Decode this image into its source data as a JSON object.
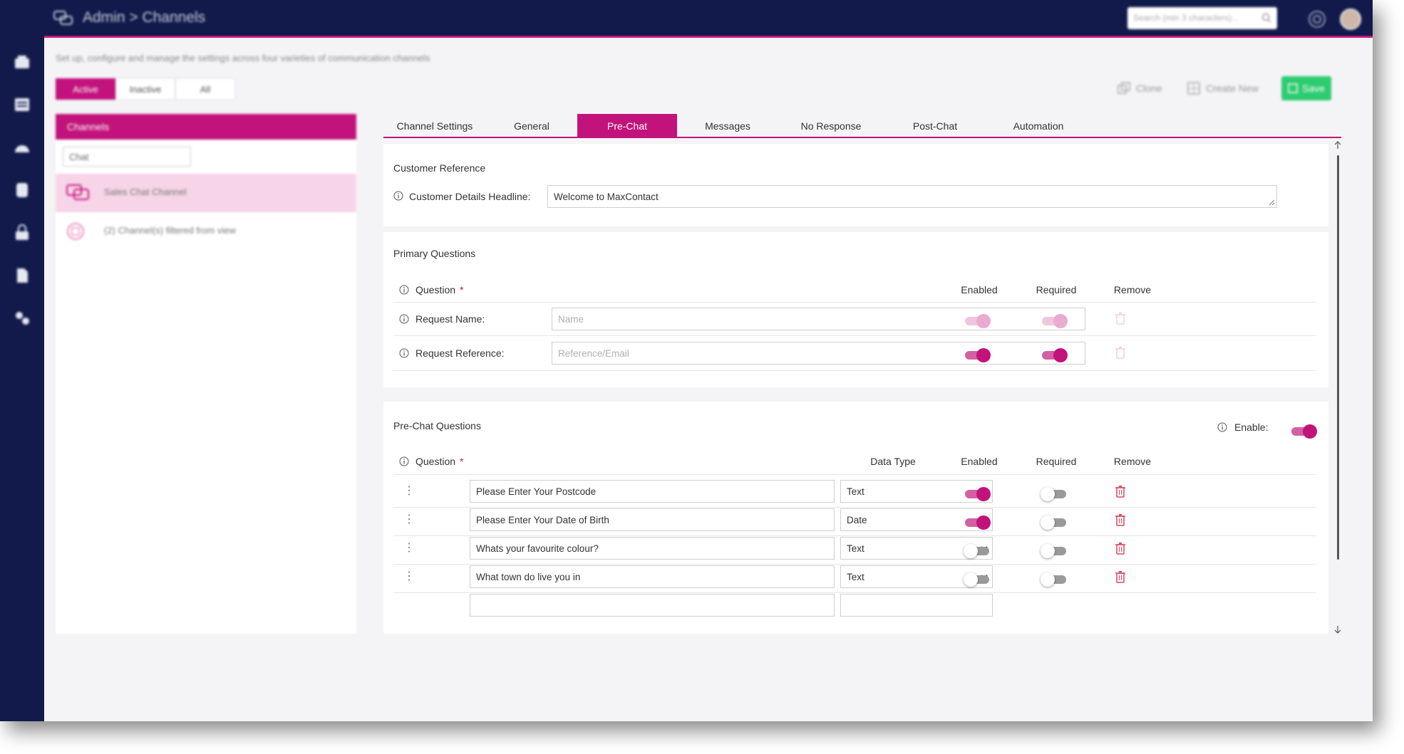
{
  "header": {
    "breadcrumb": "Admin > Channels",
    "search_placeholder": "Search (min 3 characters)..."
  },
  "page": {
    "description": "Set up, configure and manage the settings across four varieties of communication channels",
    "filter_tabs": [
      "Active",
      "Inactive",
      "All"
    ],
    "actions": {
      "clone": "Clone",
      "create_new": "Create New",
      "save": "Save"
    }
  },
  "channels_panel": {
    "title": "Channels",
    "type_filter": "Chat",
    "items": [
      {
        "label": "Sales Chat Channel"
      },
      {
        "label": "(2) Channel(s) filtered from view"
      }
    ]
  },
  "tabs": [
    "Channel Settings",
    "General",
    "Pre-Chat",
    "Messages",
    "No Response",
    "Post-Chat",
    "Automation"
  ],
  "active_tab": "Pre-Chat",
  "customer_reference": {
    "title": "Customer Reference",
    "headline_label": "Customer Details Headline:",
    "headline_value": "Welcome to MaxContact"
  },
  "primary_questions": {
    "title": "Primary Questions",
    "columns": {
      "question": "Question",
      "enabled": "Enabled",
      "required": "Required",
      "remove": "Remove"
    },
    "rows": [
      {
        "label": "Request Name:",
        "placeholder": "Name",
        "enabled": true,
        "required": true,
        "disabled": true
      },
      {
        "label": "Request Reference:",
        "placeholder": "Reference/Email",
        "enabled": true,
        "required": true,
        "disabled": false
      }
    ]
  },
  "prechat_questions": {
    "title": "Pre-Chat Questions",
    "enable_label": "Enable:",
    "enabled": true,
    "columns": {
      "question": "Question",
      "data_type": "Data Type",
      "enabled": "Enabled",
      "required": "Required",
      "remove": "Remove"
    },
    "rows": [
      {
        "question": "Please Enter Your Postcode",
        "data_type": "Text",
        "enabled": true,
        "required": false
      },
      {
        "question": "Please Enter Your Date of Birth",
        "data_type": "Date",
        "enabled": true,
        "required": false
      },
      {
        "question": "Whats your favourite colour?",
        "data_type": "Text",
        "enabled": false,
        "required": false
      },
      {
        "question": "What town do live you in",
        "data_type": "Text",
        "enabled": false,
        "required": false
      }
    ]
  },
  "colors": {
    "navy": "#111a4a",
    "accent": "#c2127b",
    "save_green": "#2ecc71",
    "delete_red": "#e0455e"
  }
}
